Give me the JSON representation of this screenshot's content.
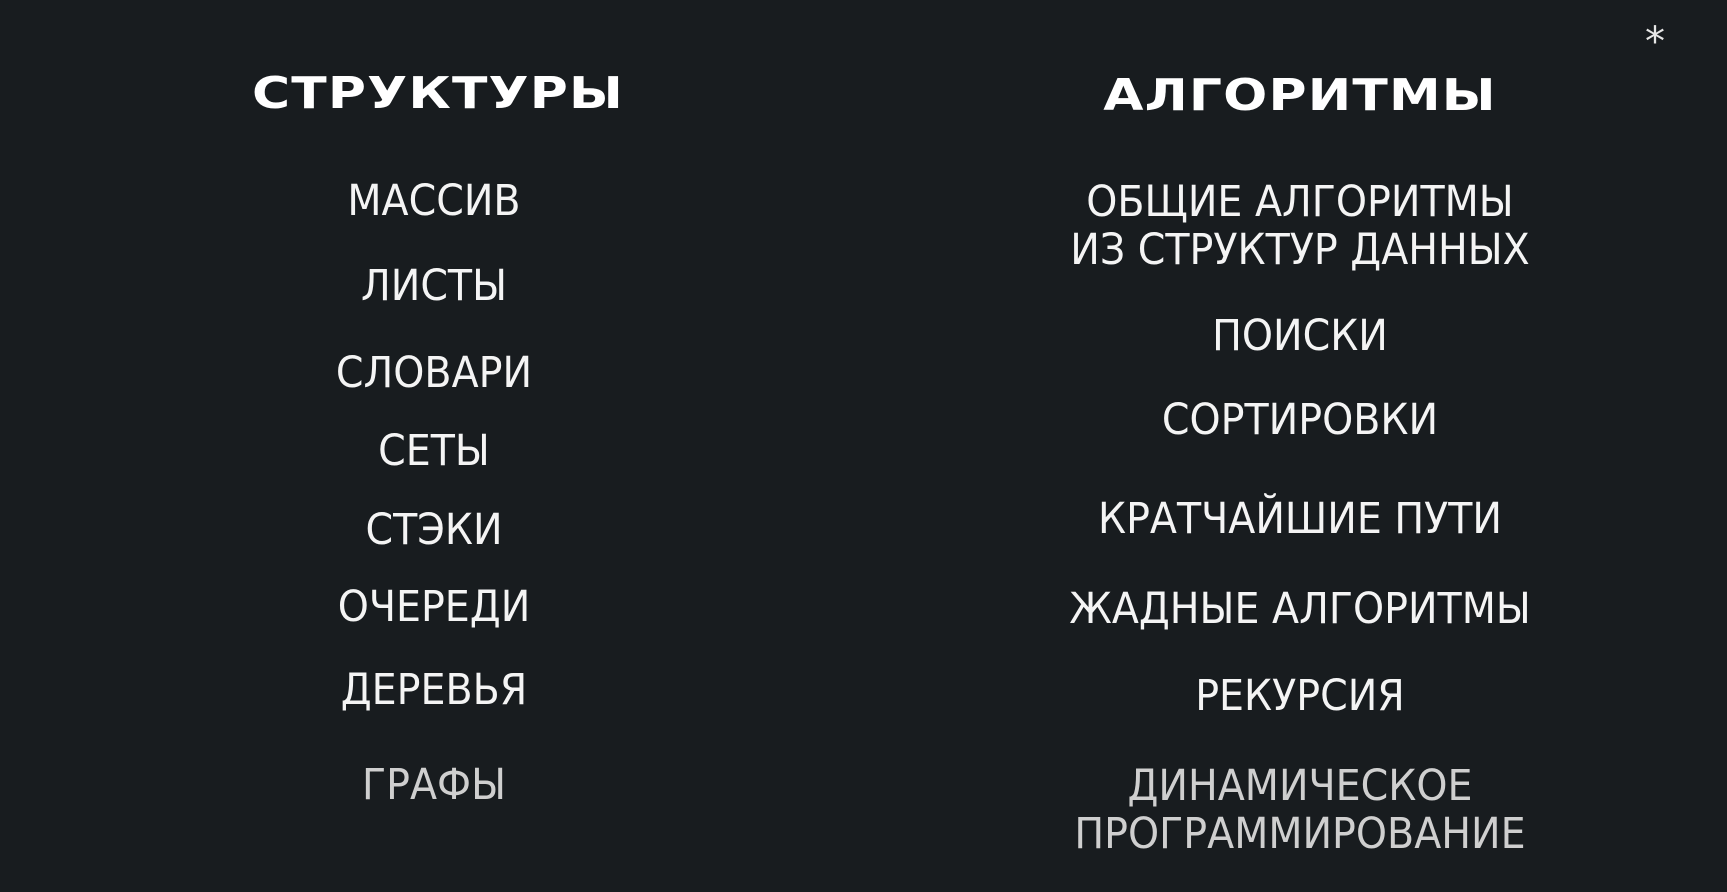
{
  "decoration": {
    "asterisk": "*"
  },
  "structures": {
    "title": "СТРУКТУРЫ",
    "items": [
      "МАССИВ",
      "ЛИСТЫ",
      "СЛОВАРИ",
      "СЕТЫ",
      "СТЭКИ",
      "ОЧЕРЕДИ",
      "ДЕРЕВЬЯ",
      "ГРАФЫ"
    ]
  },
  "algorithms": {
    "title": "АЛГОРИТМЫ",
    "items": [
      {
        "line1": "ОБЩИЕ АЛГОРИТМЫ",
        "line2": "ИЗ СТРУКТУР ДАННЫХ"
      },
      {
        "line1": "ПОИСКИ"
      },
      {
        "line1": "СОРТИРОВКИ"
      },
      {
        "line1": "КРАТЧАЙШИЕ ПУТИ"
      },
      {
        "line1": "ЖАДНЫЕ АЛГОРИТМЫ"
      },
      {
        "line1": "РЕКУРСИЯ"
      },
      {
        "line1": "ДИНАМИЧЕСКОЕ",
        "line2": "ПРОГРАММИРОВАНИЕ"
      }
    ]
  }
}
